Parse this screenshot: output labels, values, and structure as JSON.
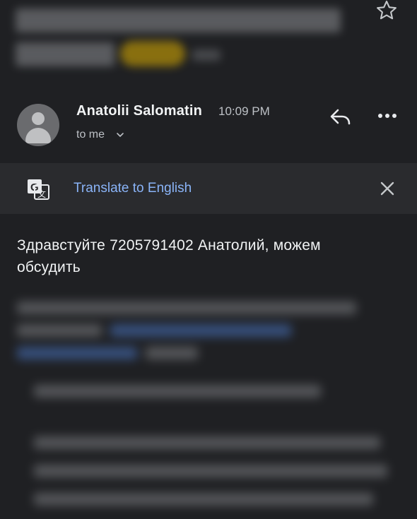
{
  "email": {
    "sender": "Anatolii Salomatin",
    "time": "10:09 PM",
    "recipient_label": "to me",
    "body": "Здравстуйте 7205791402 Анатолий, можем обсудить"
  },
  "translate_bar": {
    "link_label": "Translate to English"
  },
  "icons": {
    "star": "star-outline-icon",
    "avatar": "person-avatar-icon",
    "reply": "reply-icon",
    "more": "more-horizontal-icon",
    "translate": "google-translate-icon",
    "close": "close-icon",
    "chevron": "chevron-down-icon"
  },
  "colors": {
    "background": "#1f2023",
    "translate_bar": "#2a2b2e",
    "link": "#8ab4f8"
  }
}
